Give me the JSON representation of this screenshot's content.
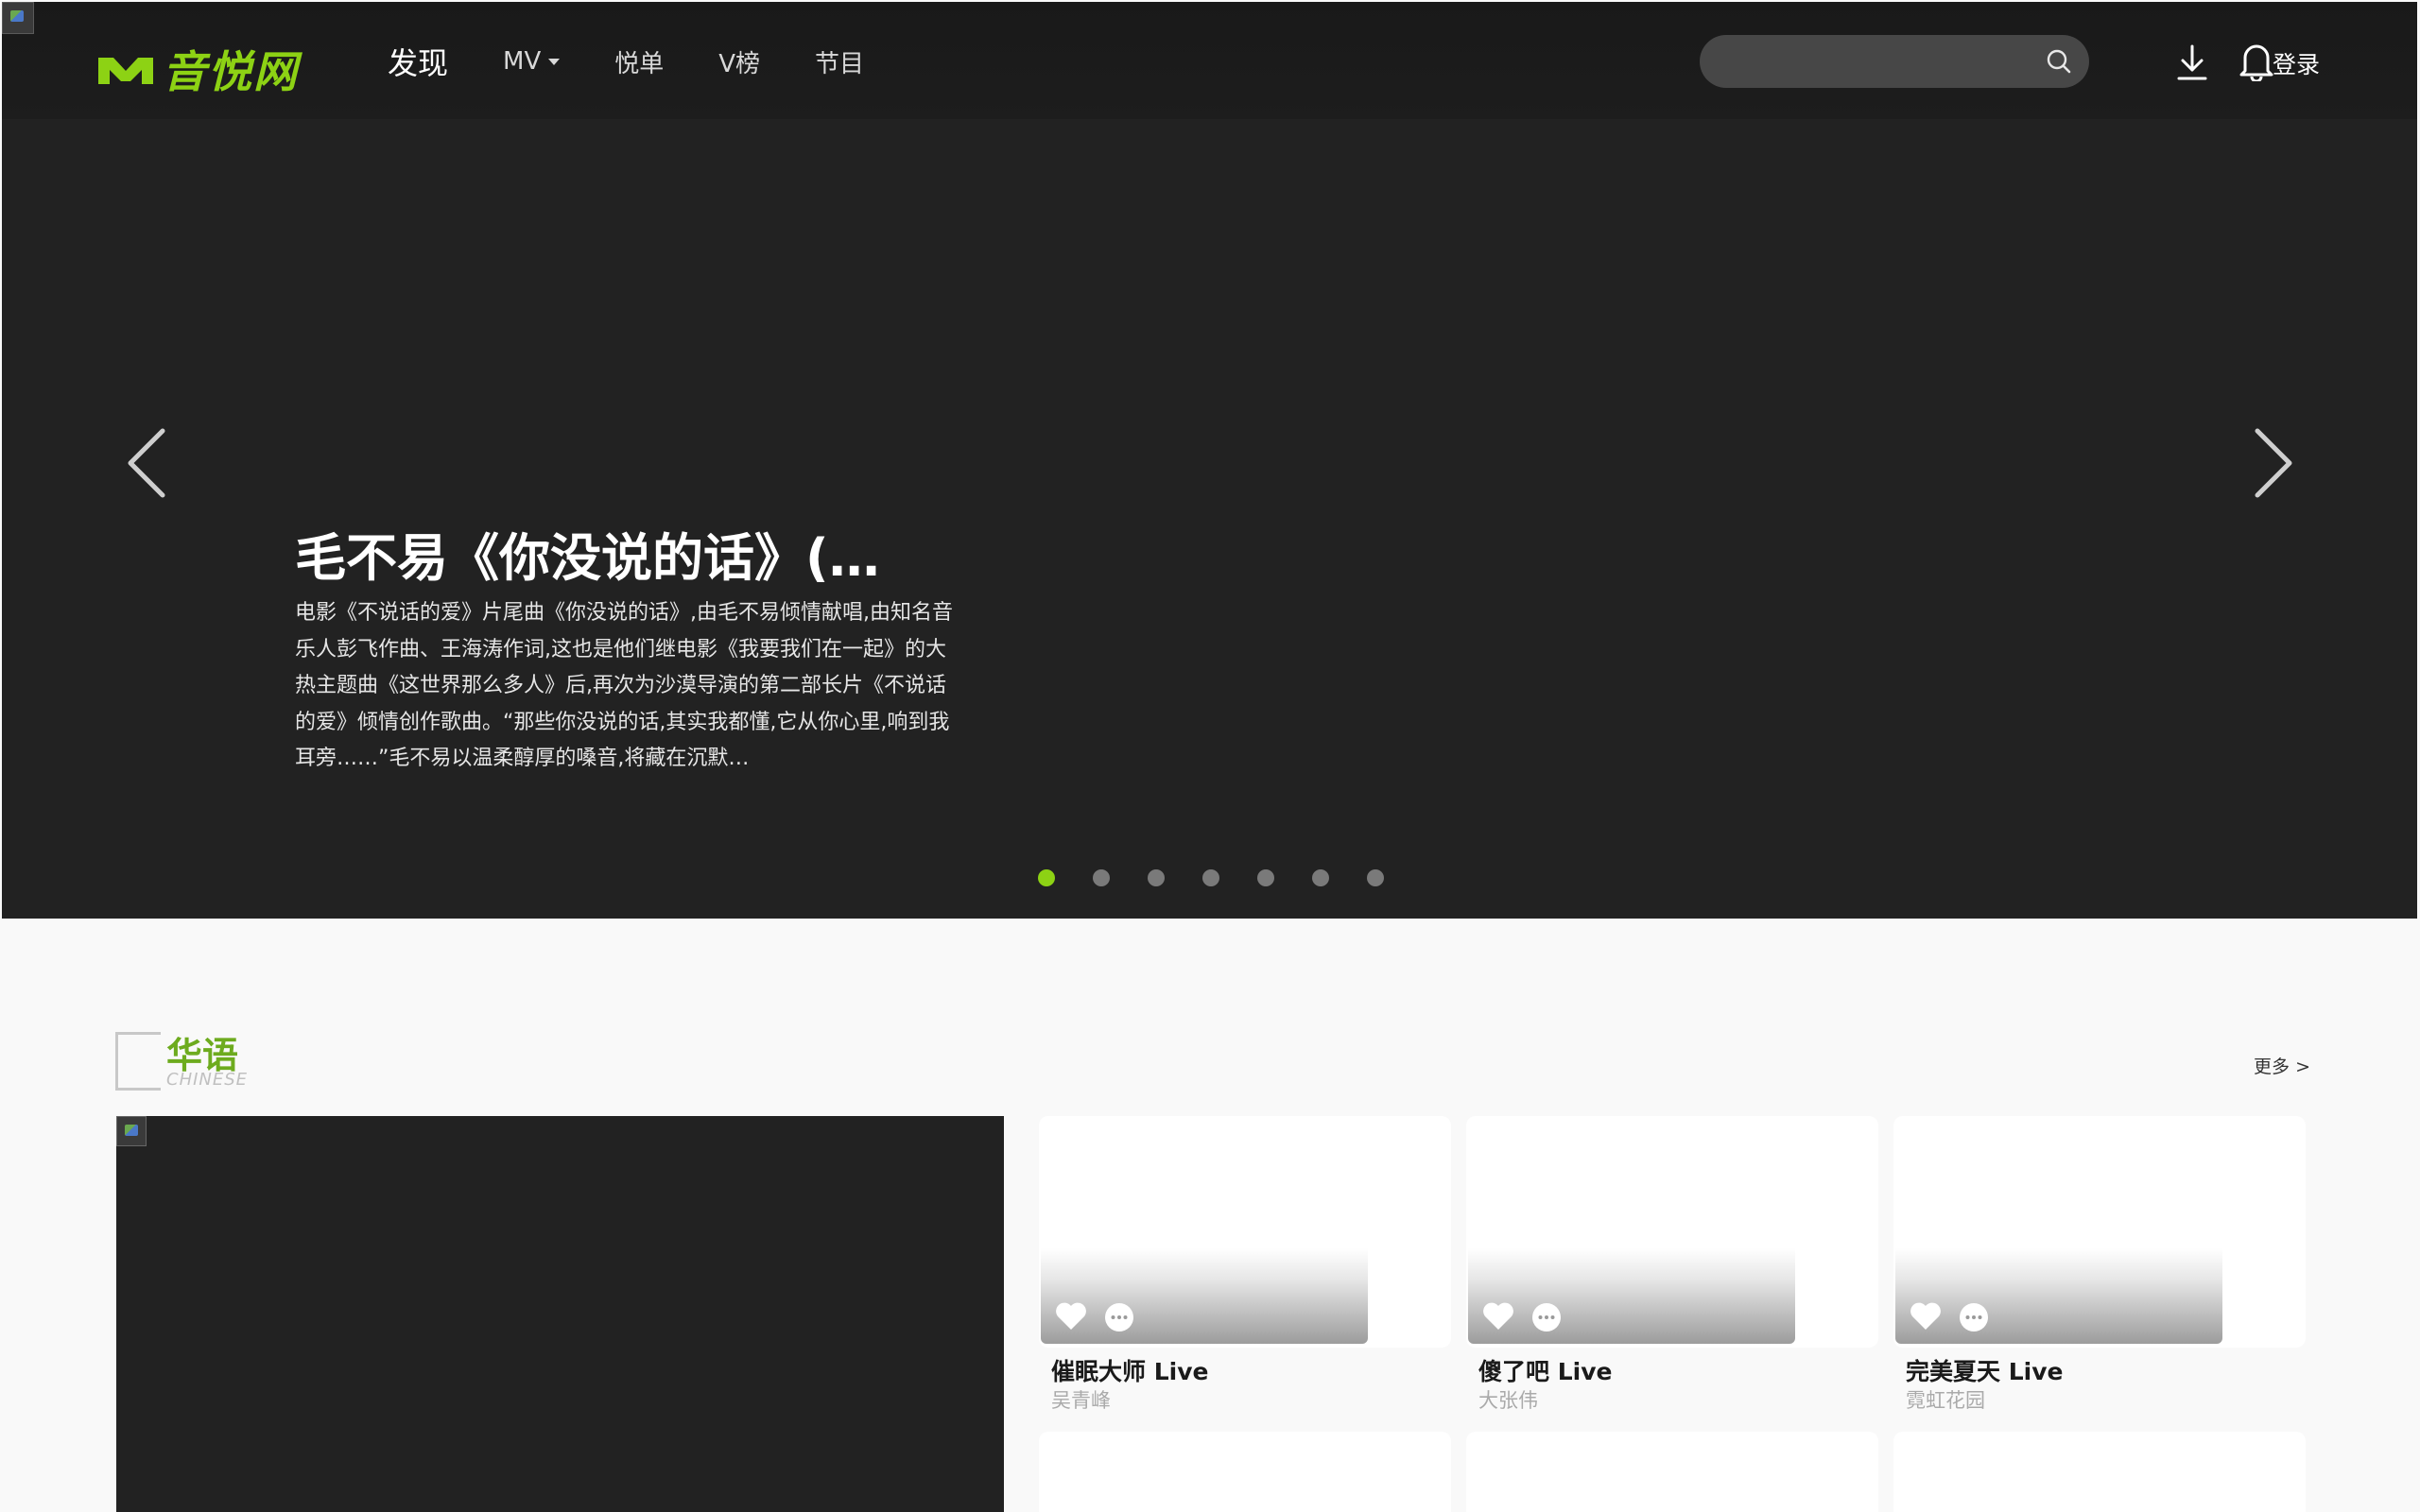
{
  "header": {
    "logo_text": "音悦网",
    "nav": [
      {
        "label": "发现"
      },
      {
        "label": "MV"
      },
      {
        "label": "悦单"
      },
      {
        "label": "V榜"
      },
      {
        "label": "节目"
      }
    ],
    "search_placeholder": "",
    "login_label": "登录"
  },
  "banner": {
    "title": "毛不易《你没说的话》(…",
    "description": "电影《不说话的爱》片尾曲《你没说的话》,由毛不易倾情献唱,由知名音乐人彭飞作曲、王海涛作词,这也是他们继电影《我要我们在一起》的大热主题曲《这世界那么多人》后,再次为沙漠导演的第二部长片《不说话的爱》倾情创作歌曲。“那些你没说的话,其实我都懂,它从你心里,响到我耳旁……”毛不易以温柔醇厚的嗓音,将藏在沉默…",
    "dot_count": 7,
    "active_dot": 0
  },
  "section": {
    "title": "华语",
    "subtitle": "CHINESE",
    "more_label": "更多 >"
  },
  "videos": [
    {
      "title": "催眠大师 Live",
      "artist": "吴青峰"
    },
    {
      "title": "傻了吧 Live",
      "artist": "大张伟"
    },
    {
      "title": "完美夏天 Live",
      "artist": "霓虹花园"
    }
  ],
  "colors": {
    "accent": "#8dd214",
    "section_title": "#6dab1e",
    "hero_bg": "#222222",
    "page_bg": "#f9f9f9"
  }
}
